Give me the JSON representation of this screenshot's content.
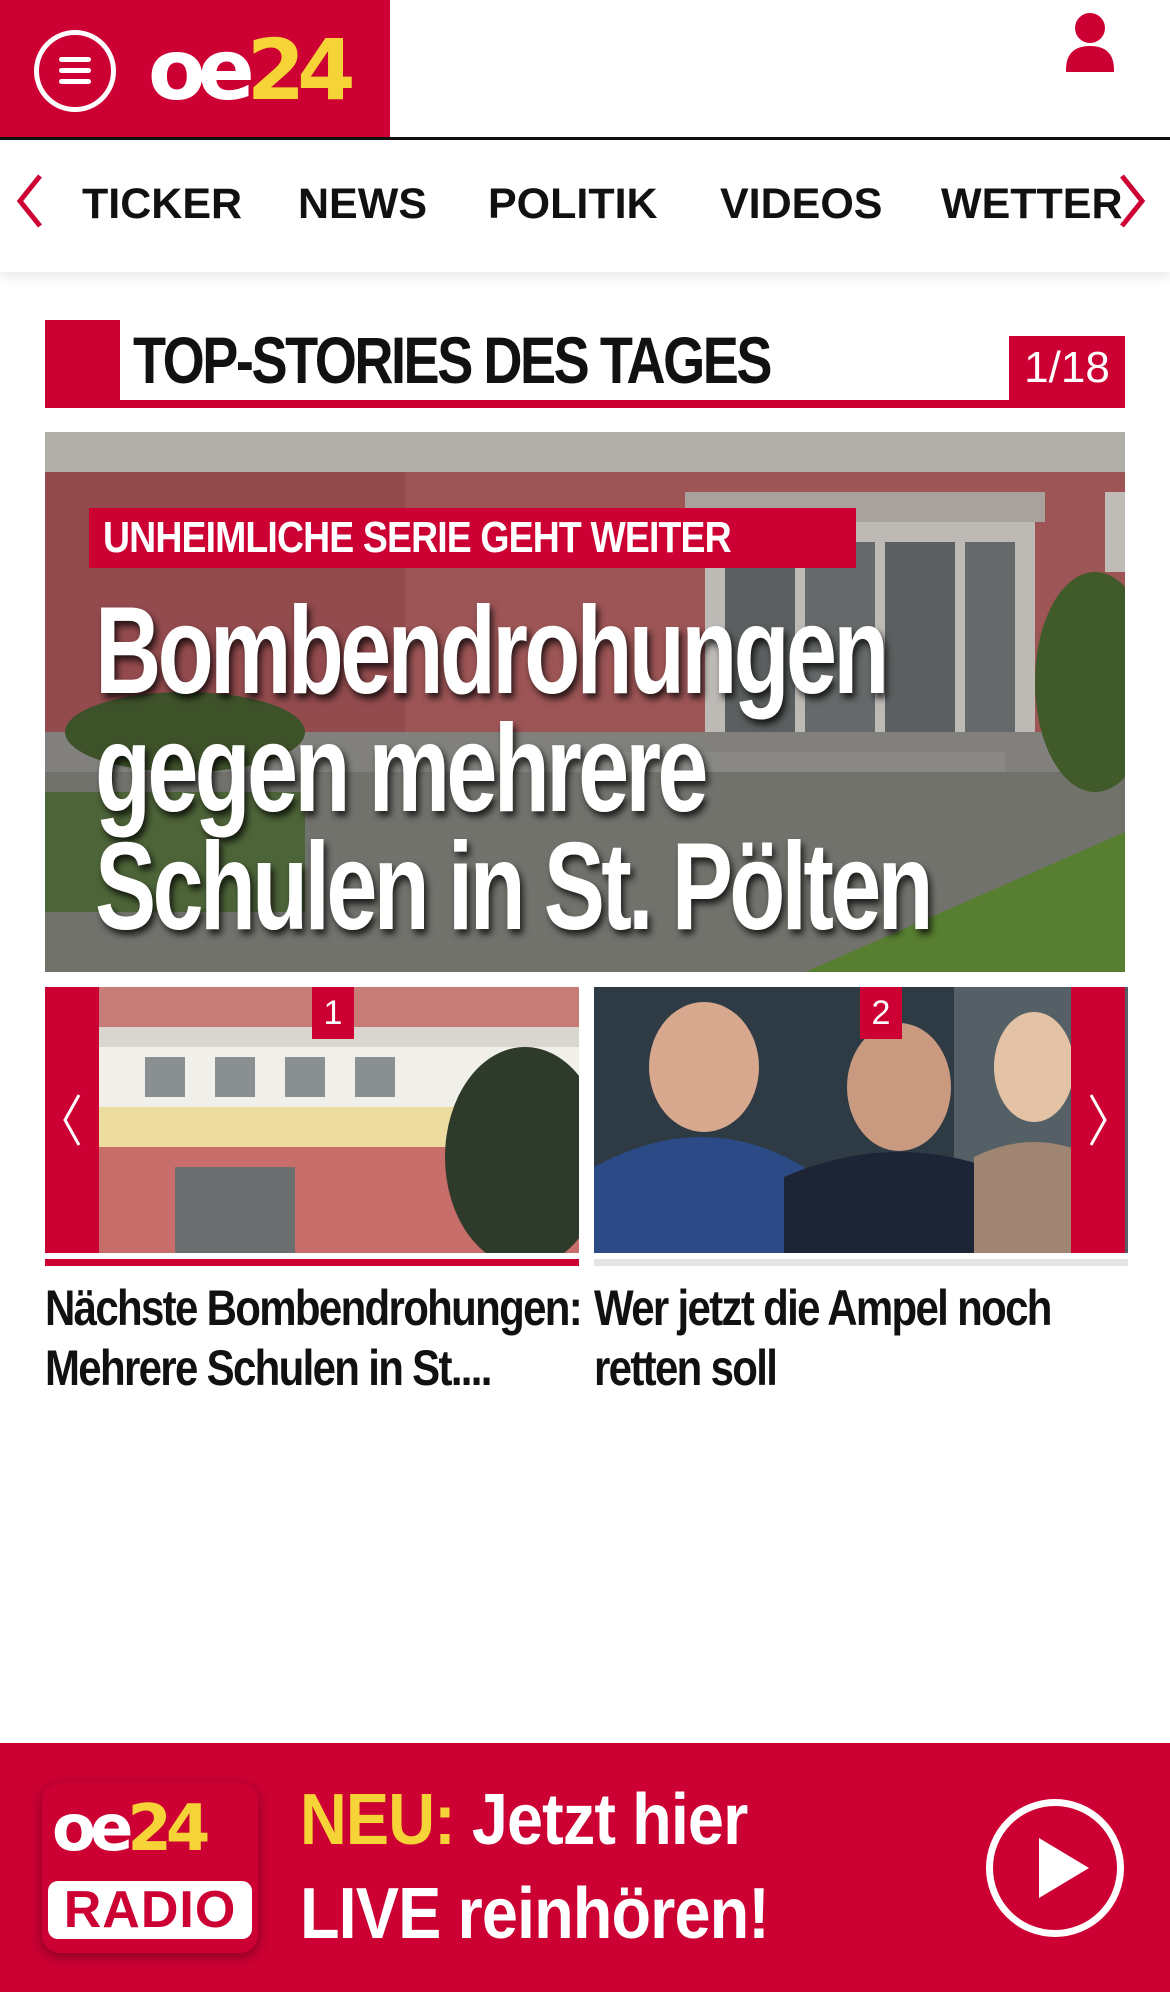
{
  "header": {
    "logo_oe": "oe",
    "logo_24": "24"
  },
  "nav": {
    "items": [
      "TICKER",
      "NEWS",
      "POLITIK",
      "VIDEOS",
      "WETTER"
    ]
  },
  "section": {
    "title": "TOP-STORIES DES TAGES",
    "counter": "1/18"
  },
  "hero": {
    "kicker": "UNHEIMLICHE SERIE GEHT WEITER",
    "headline_lines": [
      "Bombendrohungen",
      "gegen mehrere",
      "Schulen in St. Pölten"
    ]
  },
  "cards": [
    {
      "number": "1",
      "title": "Nächste Bombendrohungen: Mehrere Schulen in St...."
    },
    {
      "number": "2",
      "title": "Wer jetzt die Ampel noch retten soll"
    }
  ],
  "radio": {
    "logo_oe": "oe",
    "logo_24": "24",
    "logo_label": "RADIO",
    "neu": "NEU:",
    "line1_rest": " Jetzt hier",
    "line2": "LIVE reinhören!"
  },
  "colors": {
    "brand_red": "#cc0033",
    "brand_yellow": "#f6d438"
  },
  "icons": [
    "menu-icon",
    "user-icon",
    "chevron-left-icon",
    "chevron-right-icon",
    "play-icon"
  ]
}
